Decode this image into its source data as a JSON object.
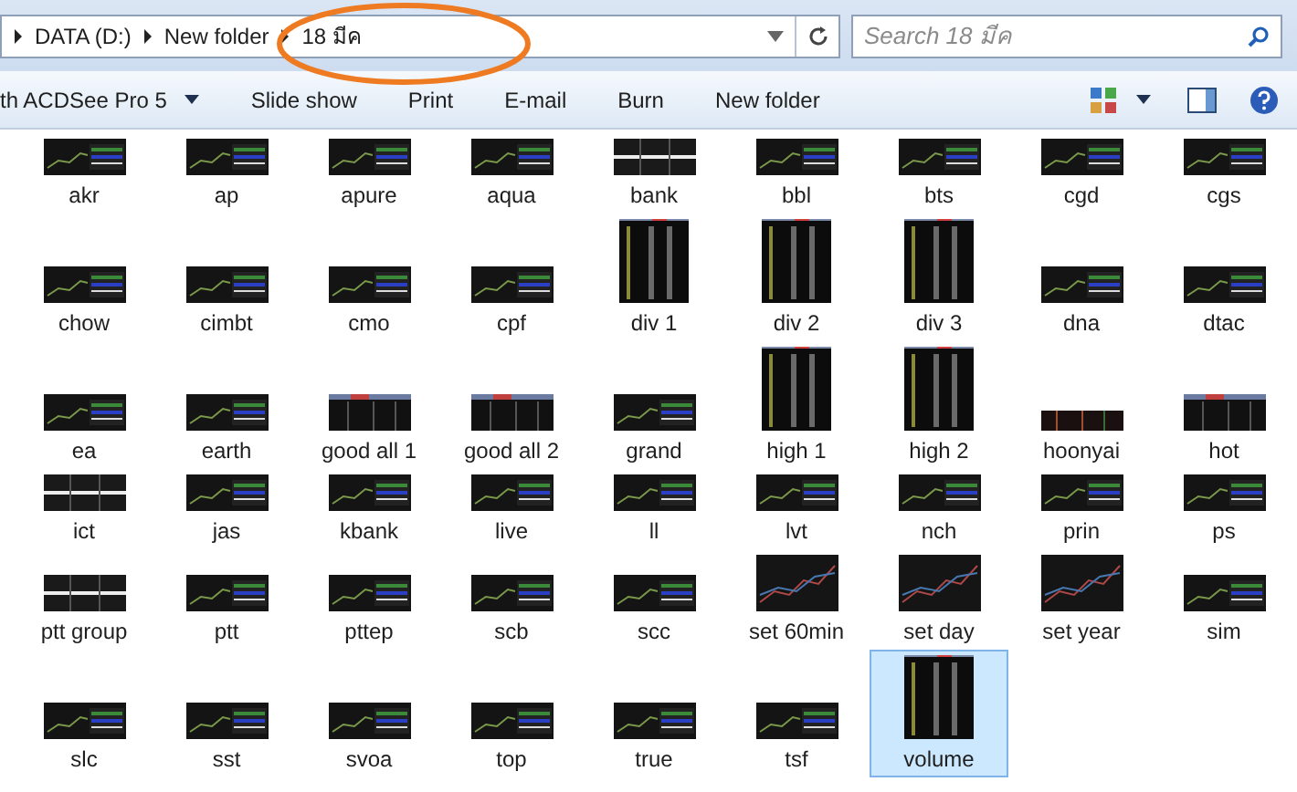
{
  "address_bar": {
    "breadcrumbs": [
      "DATA (D:)",
      "New folder",
      "18 มีค"
    ],
    "search": {
      "placeholder": "Search 18 มีค"
    }
  },
  "toolbar": {
    "items": [
      {
        "label": "th ACDSee Pro 5",
        "dropdown": true
      },
      {
        "label": "Slide show",
        "dropdown": false
      },
      {
        "label": "Print",
        "dropdown": false
      },
      {
        "label": "E-mail",
        "dropdown": false
      },
      {
        "label": "Burn",
        "dropdown": false
      },
      {
        "label": "New folder",
        "dropdown": false
      }
    ]
  },
  "files": [
    {
      "name": "akr",
      "kind": "chart",
      "selected": false
    },
    {
      "name": "ap",
      "kind": "chart",
      "selected": false
    },
    {
      "name": "apure",
      "kind": "chart",
      "selected": false
    },
    {
      "name": "aqua",
      "kind": "chart",
      "selected": false
    },
    {
      "name": "bank",
      "kind": "grid",
      "selected": false
    },
    {
      "name": "bbl",
      "kind": "chart",
      "selected": false
    },
    {
      "name": "bts",
      "kind": "chart",
      "selected": false
    },
    {
      "name": "cgd",
      "kind": "chart",
      "selected": false
    },
    {
      "name": "cgs",
      "kind": "chart",
      "selected": false
    },
    {
      "name": "chow",
      "kind": "chart",
      "selected": false
    },
    {
      "name": "cimbt",
      "kind": "chart",
      "selected": false
    },
    {
      "name": "cmo",
      "kind": "chart",
      "selected": false
    },
    {
      "name": "cpf",
      "kind": "chart",
      "selected": false
    },
    {
      "name": "div 1",
      "kind": "tall",
      "selected": false
    },
    {
      "name": "div 2",
      "kind": "tall",
      "selected": false
    },
    {
      "name": "div 3",
      "kind": "tall",
      "selected": false
    },
    {
      "name": "dna",
      "kind": "chart",
      "selected": false
    },
    {
      "name": "dtac",
      "kind": "chart",
      "selected": false
    },
    {
      "name": "ea",
      "kind": "chart",
      "selected": false
    },
    {
      "name": "earth",
      "kind": "chart",
      "selected": false
    },
    {
      "name": "good all 1",
      "kind": "table",
      "selected": false
    },
    {
      "name": "good all 2",
      "kind": "table",
      "selected": false
    },
    {
      "name": "grand",
      "kind": "chart",
      "selected": false
    },
    {
      "name": "high 1",
      "kind": "tall",
      "selected": false
    },
    {
      "name": "high 2",
      "kind": "tall",
      "selected": false
    },
    {
      "name": "hoonyai",
      "kind": "strip",
      "selected": false
    },
    {
      "name": "hot",
      "kind": "table",
      "selected": false
    },
    {
      "name": "ict",
      "kind": "grid",
      "selected": false
    },
    {
      "name": "jas",
      "kind": "chart",
      "selected": false
    },
    {
      "name": "kbank",
      "kind": "chart",
      "selected": false
    },
    {
      "name": "live",
      "kind": "chart",
      "selected": false
    },
    {
      "name": "ll",
      "kind": "chart",
      "selected": false
    },
    {
      "name": "lvt",
      "kind": "chart",
      "selected": false
    },
    {
      "name": "nch",
      "kind": "chart",
      "selected": false
    },
    {
      "name": "prin",
      "kind": "chart",
      "selected": false
    },
    {
      "name": "ps",
      "kind": "chart",
      "selected": false
    },
    {
      "name": "ptt group",
      "kind": "grid",
      "selected": false
    },
    {
      "name": "ptt",
      "kind": "chart",
      "selected": false
    },
    {
      "name": "pttep",
      "kind": "chart",
      "selected": false
    },
    {
      "name": "scb",
      "kind": "chart",
      "selected": false
    },
    {
      "name": "scc",
      "kind": "chart",
      "selected": false
    },
    {
      "name": "set 60min",
      "kind": "large",
      "selected": false
    },
    {
      "name": "set day",
      "kind": "large",
      "selected": false
    },
    {
      "name": "set year",
      "kind": "large",
      "selected": false
    },
    {
      "name": "sim",
      "kind": "chart",
      "selected": false
    },
    {
      "name": "slc",
      "kind": "chart",
      "selected": false
    },
    {
      "name": "sst",
      "kind": "chart",
      "selected": false
    },
    {
      "name": "svoa",
      "kind": "chart",
      "selected": false
    },
    {
      "name": "top",
      "kind": "chart",
      "selected": false
    },
    {
      "name": "true",
      "kind": "chart",
      "selected": false
    },
    {
      "name": "tsf",
      "kind": "chart",
      "selected": false
    },
    {
      "name": "volume",
      "kind": "tall",
      "selected": true
    }
  ]
}
